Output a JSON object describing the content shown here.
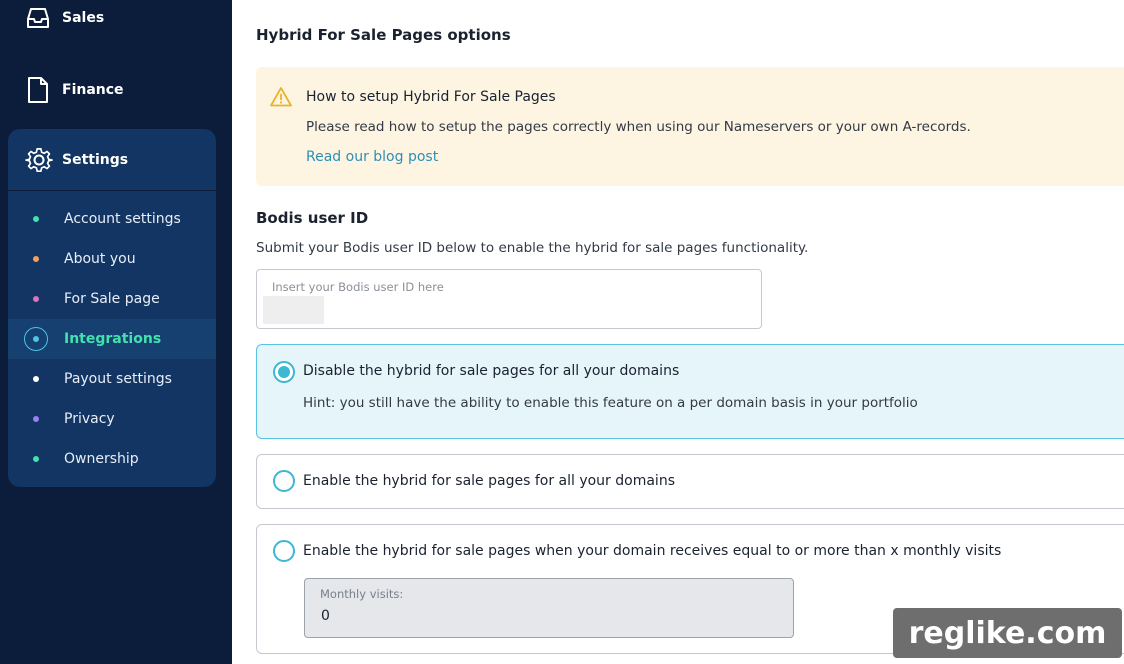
{
  "sidebar": {
    "top_items": [
      {
        "label": "Sales",
        "icon": "inbox-icon"
      },
      {
        "label": "Finance",
        "icon": "document-icon"
      }
    ],
    "settings": {
      "label": "Settings",
      "icon": "gear-icon",
      "items": [
        {
          "label": "Account settings",
          "dot_color": "#43e0b0"
        },
        {
          "label": "About you",
          "dot_color": "#f0a060"
        },
        {
          "label": "For Sale page",
          "dot_color": "#e070c0"
        },
        {
          "label": "Integrations",
          "dot_color": "#4cc4e6",
          "active": true
        },
        {
          "label": "Payout settings",
          "dot_color": "#ffffff"
        },
        {
          "label": "Privacy",
          "dot_color": "#9a80f0"
        },
        {
          "label": "Ownership",
          "dot_color": "#43e0b0"
        }
      ]
    }
  },
  "main": {
    "title": "Hybrid For Sale Pages options",
    "alert": {
      "icon": "warning-icon",
      "title": "How to setup Hybrid For Sale Pages",
      "text": "Please read how to setup the pages correctly when using our Nameservers or your own A-records.",
      "link": "Read our blog post"
    },
    "bodis": {
      "title": "Bodis user ID",
      "description": "Submit your Bodis user ID below to enable the hybrid for sale pages functionality.",
      "input_label": "Insert your Bodis user ID here"
    },
    "options": [
      {
        "label": "Disable the hybrid for sale pages for all your domains",
        "hint": "Hint: you still have the ability to enable this feature on a per domain basis in your portfolio",
        "selected": true
      },
      {
        "label": "Enable the hybrid for sale pages for all your domains",
        "selected": false
      },
      {
        "label": "Enable the hybrid for sale pages when your domain receives equal to or more than x monthly visits",
        "selected": false,
        "visits_label": "Monthly visits:",
        "visits_value": "0"
      }
    ]
  },
  "watermark": "reglike.com",
  "colors": {
    "sidebar_bg": "#0b1d3a",
    "panel_bg": "#123563",
    "active_text": "#43e0b0",
    "accent": "#3cb8d3",
    "alert_bg": "#fdf5e2",
    "link": "#2e8fb5"
  }
}
